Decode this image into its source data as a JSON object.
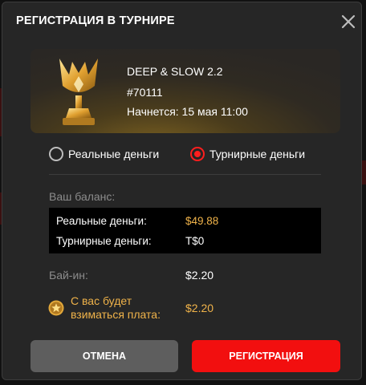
{
  "dialog": {
    "title": "РЕГИСТРАЦИЯ В ТУРНИРЕ"
  },
  "tournament": {
    "name": "DEEP & SLOW 2.2",
    "id": "#70111",
    "start": "Начнется: 15 мая 11:00"
  },
  "payment_options": [
    {
      "label": "Реальные деньги",
      "selected": false
    },
    {
      "label": "Турнирные деньги",
      "selected": true
    }
  ],
  "balance": {
    "label": "Ваш баланс:",
    "rows": [
      {
        "label": "Реальные деньги:",
        "value": "$49.88"
      },
      {
        "label": "Турнирные деньги:",
        "value": "T$0"
      }
    ]
  },
  "buyin": {
    "label": "Бай-ин:",
    "value": "$2.20"
  },
  "fee": {
    "label": "С вас будет взиматься плата:",
    "value": "$2.20"
  },
  "buttons": {
    "cancel": "ОТМЕНА",
    "register": "РЕГИСТРАЦИЯ"
  },
  "colors": {
    "accent": "#f20f0f",
    "gold": "#f0b34a",
    "panel": "#262626"
  },
  "icons": {
    "close": "close-icon",
    "trophy": "trophy-icon",
    "coin": "star-coin-icon"
  }
}
